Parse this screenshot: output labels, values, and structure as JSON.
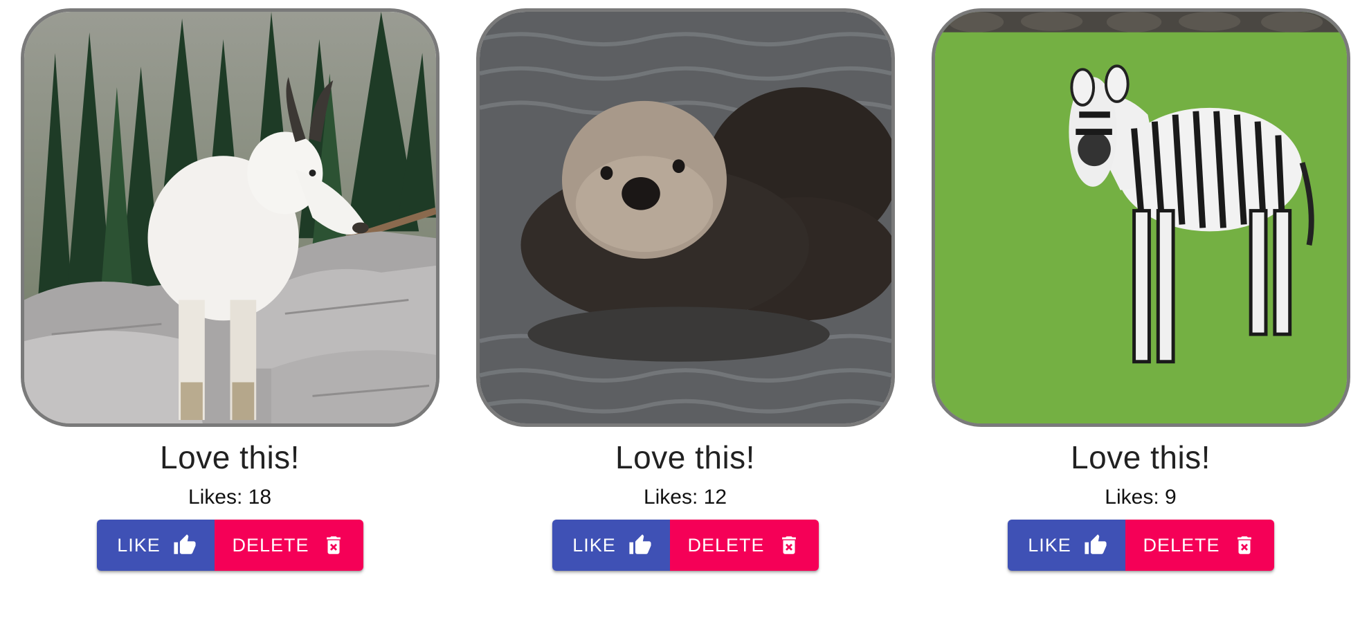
{
  "cards": [
    {
      "subject": "mountain goat",
      "caption": "Love this!",
      "likes_text": "Likes: 18",
      "like_label": "LIKE",
      "delete_label": "DELETE"
    },
    {
      "subject": "sea otter",
      "caption": "Love this!",
      "likes_text": "Likes: 12",
      "like_label": "LIKE",
      "delete_label": "DELETE"
    },
    {
      "subject": "zebra",
      "caption": "Love this!",
      "likes_text": "Likes: 9",
      "like_label": "LIKE",
      "delete_label": "DELETE"
    }
  ],
  "colors": {
    "like_button": "#3f51b5",
    "delete_button": "#f50057",
    "image_border": "#7a7a7a",
    "caption_text": "#212121"
  },
  "icons": {
    "like": "thumb-up-icon",
    "delete": "trash-icon"
  }
}
